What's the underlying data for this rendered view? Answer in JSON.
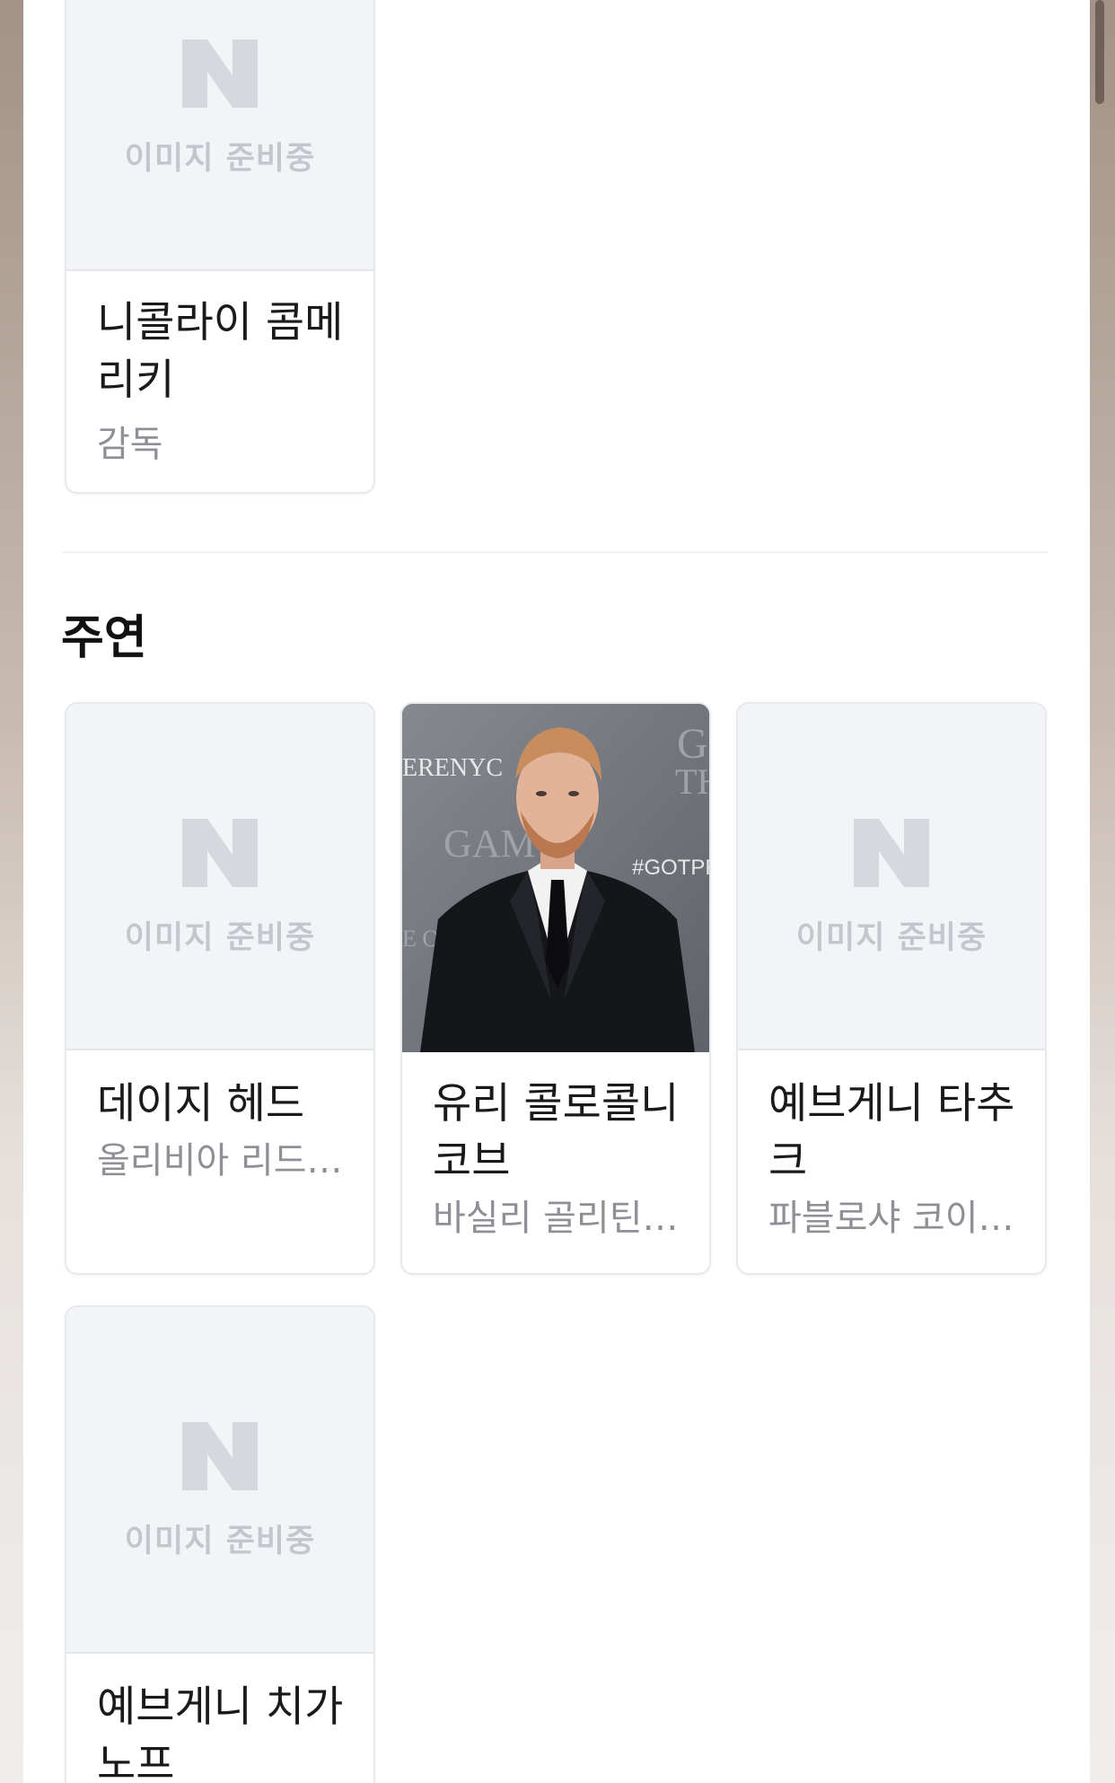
{
  "placeholder": {
    "text": "이미지 준비중"
  },
  "director_card": {
    "name": "니콜라이 콤메리키",
    "role": "감독"
  },
  "cast_section": {
    "title": "주연",
    "cards": [
      {
        "name": "데이지 헤드",
        "role": "올리비아 리드…"
      },
      {
        "name": "유리 콜로콜니코브",
        "role": "바실리 골리틴…"
      },
      {
        "name": "예브게니 타추크",
        "role": "파블로샤 코이…"
      },
      {
        "name": "예브게니 치가노프",
        "role": ""
      }
    ]
  },
  "photo_signage": {
    "left_text": "ERENYC",
    "right_text": "#GOTPR",
    "game_text": "GAM",
    "of_text": "E OF"
  },
  "colors": {
    "placeholder_bg": "#f3f4f7",
    "placeholder_text": "#c3c6cc",
    "n_logo": "#d5d8dd",
    "role_text": "#8e9096"
  }
}
